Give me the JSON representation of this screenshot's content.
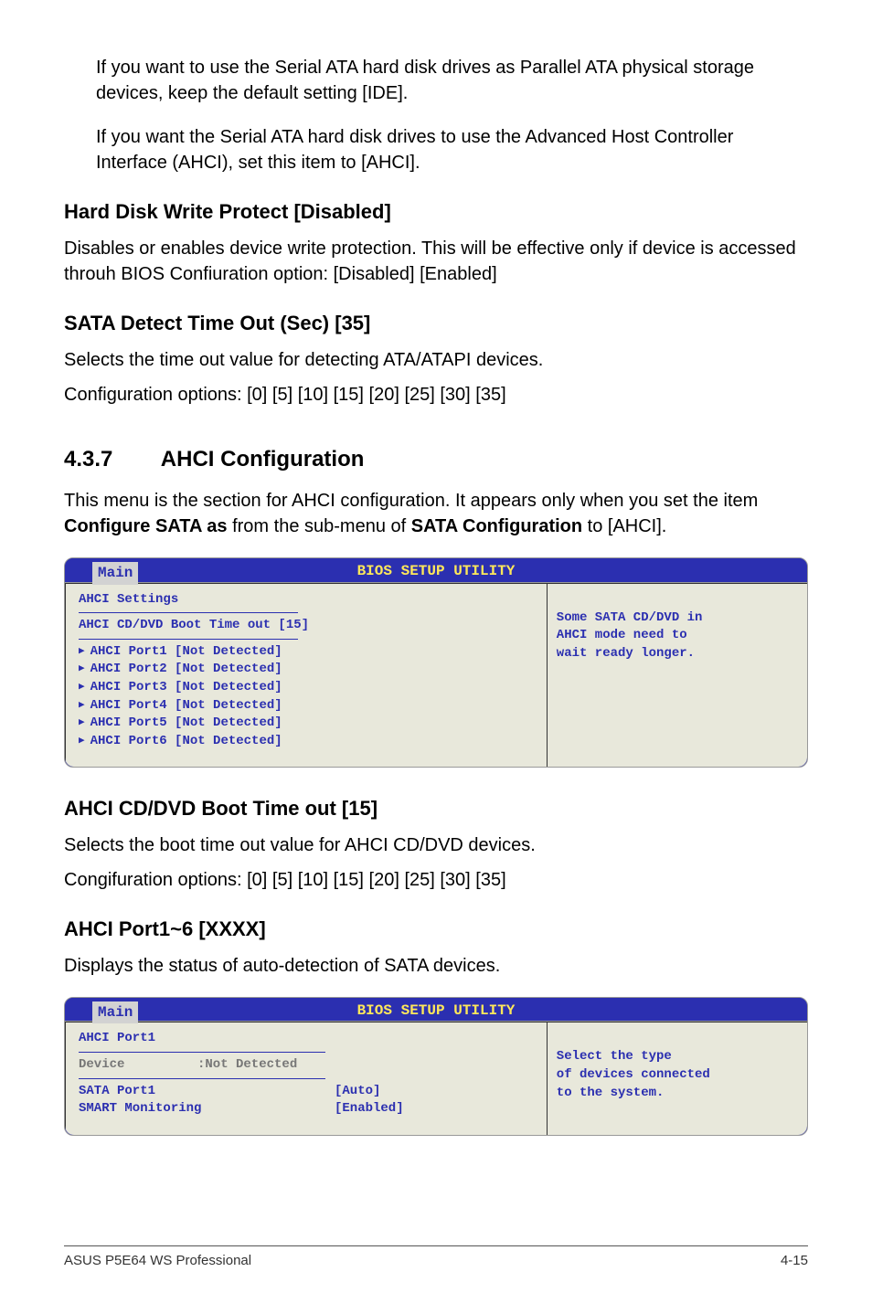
{
  "intro": {
    "p1": "If you want to use the Serial ATA hard disk drives as Parallel ATA physical storage devices, keep the default setting [IDE].",
    "p2": "If you want the Serial ATA hard disk drives to use the Advanced Host Controller Interface (AHCI), set this item to [AHCI]."
  },
  "section1": {
    "title": "Hard Disk Write Protect [Disabled]",
    "desc": "Disables or enables device write protection. This will be effective only if device is accessed throuh BIOS Confiuration option: [Disabled] [Enabled]"
  },
  "section2": {
    "title": "SATA Detect Time Out (Sec) [35]",
    "desc1": "Selects the time out value for detecting ATA/ATAPI devices.",
    "desc2": "Configuration options: [0] [5] [10] [15] [20] [25] [30] [35]"
  },
  "sectionMain": {
    "num": "4.3.7",
    "title": "AHCI Configuration",
    "desc_a": "This menu is the section for AHCI configuration. It appears only when you set the item ",
    "desc_b": "Configure SATA as",
    "desc_c": " from the sub-menu of ",
    "desc_d": "SATA Configuration",
    "desc_e": " to [AHCI]."
  },
  "bios1": {
    "header": "BIOS SETUP UTILITY",
    "tab": "Main",
    "settings_title": "AHCI Settings",
    "boot_time": "AHCI CD/DVD Boot Time out [15]",
    "ports": [
      "AHCI Port1 [Not Detected]",
      "AHCI Port2 [Not Detected]",
      "AHCI Port3 [Not Detected]",
      "AHCI Port4 [Not Detected]",
      "AHCI Port5 [Not Detected]",
      "AHCI Port6 [Not Detected]"
    ],
    "help1": "Some SATA CD/DVD in",
    "help2": "AHCI mode need to",
    "help3": "wait ready longer."
  },
  "section3": {
    "title": "AHCI CD/DVD Boot Time out [15]",
    "desc1": "Selects the boot time out value for AHCI CD/DVD devices.",
    "desc2": "Congifuration options: [0] [5] [10] [15] [20] [25] [30] [35]"
  },
  "section4": {
    "title": "AHCI Port1~6 [XXXX]",
    "desc": "Displays the status of auto-detection of SATA devices."
  },
  "bios2": {
    "header": "BIOS SETUP UTILITY",
    "tab": "Main",
    "title": "AHCI Port1",
    "device_label": "Device",
    "device_value": ":Not Detected",
    "sata_label": "SATA Port1",
    "sata_value": "[Auto]",
    "smart_label": "SMART Monitoring",
    "smart_value": "[Enabled]",
    "help1": "Select the type",
    "help2": "of devices connected",
    "help3": "to the system."
  },
  "footer": {
    "left": "ASUS P5E64 WS Professional",
    "right": "4-15"
  }
}
